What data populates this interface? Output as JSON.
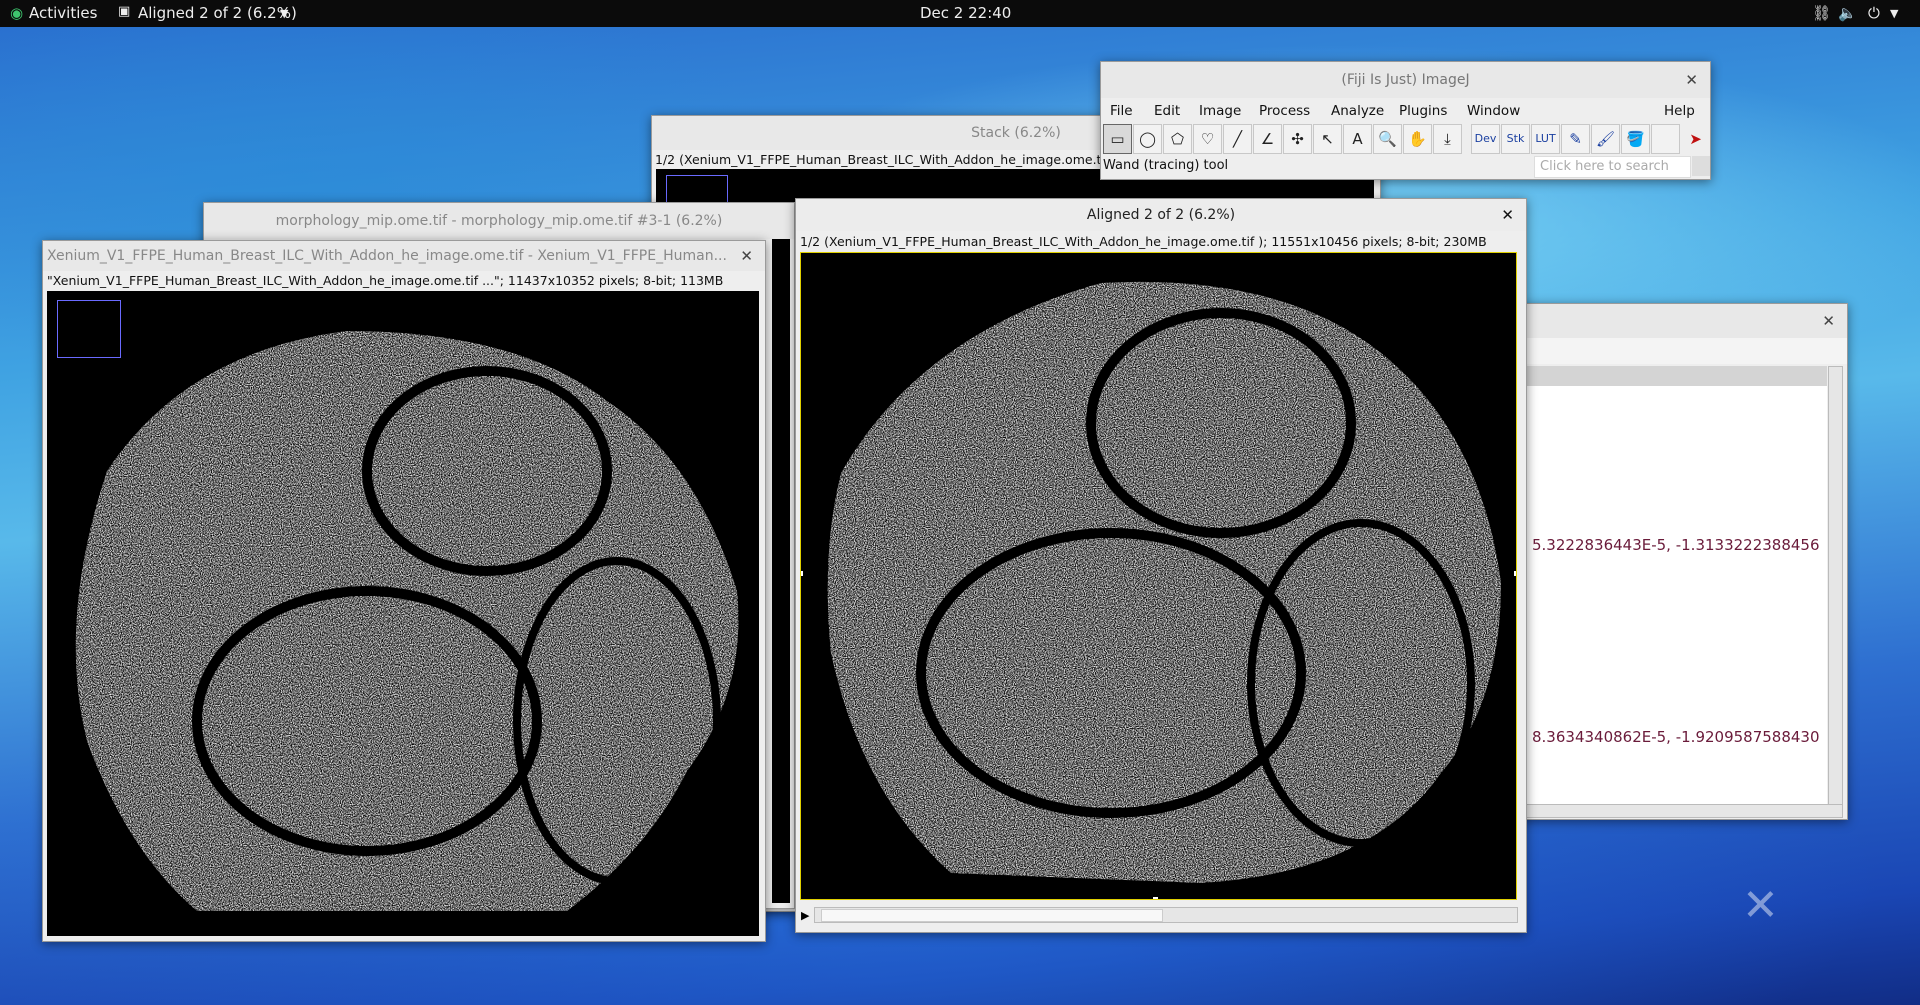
{
  "topbar": {
    "activities": "Activities",
    "app_title": "Aligned 2 of 2 (6.2%)",
    "clock": "Dec 2  22:40"
  },
  "fiji": {
    "title": "(Fiji Is Just) ImageJ",
    "menus": [
      "File",
      "Edit",
      "Image",
      "Process",
      "Analyze",
      "Plugins",
      "Window",
      "Help"
    ],
    "tools": [
      "▭",
      "◯",
      "⬠",
      "♡",
      "╱",
      "∠",
      "✣",
      "↖",
      "A",
      "🔍",
      "✋",
      "⤓",
      "Dev",
      "Stk",
      "LUT",
      "✎",
      "🖌",
      "🪣",
      "",
      "➤"
    ],
    "status": "Wand (tracing) tool",
    "search_placeholder": "Click here to search"
  },
  "stack": {
    "title": "Stack (6.2%)",
    "info": "1/2 (Xenium_V1_FFPE_Human_Breast_ILC_With_Addon_he_image.ome.tif"
  },
  "morph": {
    "title": "morphology_mip.ome.tif - morphology_mip.ome.tif #3-1 (6.2%)"
  },
  "he": {
    "title": "Xenium_V1_FFPE_Human_Breast_ILC_With_Addon_he_image.ome.tif - Xenium_V1_FFPE_Human...",
    "info": "\"Xenium_V1_FFPE_Human_Breast_ILC_With_Addon_he_image.ome.tif ...\"; 11437x10352 pixels; 8-bit; 113MB"
  },
  "aligned": {
    "title": "Aligned 2 of 2 (6.2%)",
    "info": "1/2 (Xenium_V1_FFPE_Human_Breast_ILC_With_Addon_he_image.ome.tif ); 11551x10456 pixels; 8-bit; 230MB"
  },
  "log": {
    "line1": "5.3222836443E-5, -1.3133222388456",
    "line2": "8.3634340862E-5, -1.9209587588430"
  },
  "colors": {
    "accent": "#0f7b3c",
    "roi": "#e0d000",
    "log_text": "#6a1b3a"
  }
}
